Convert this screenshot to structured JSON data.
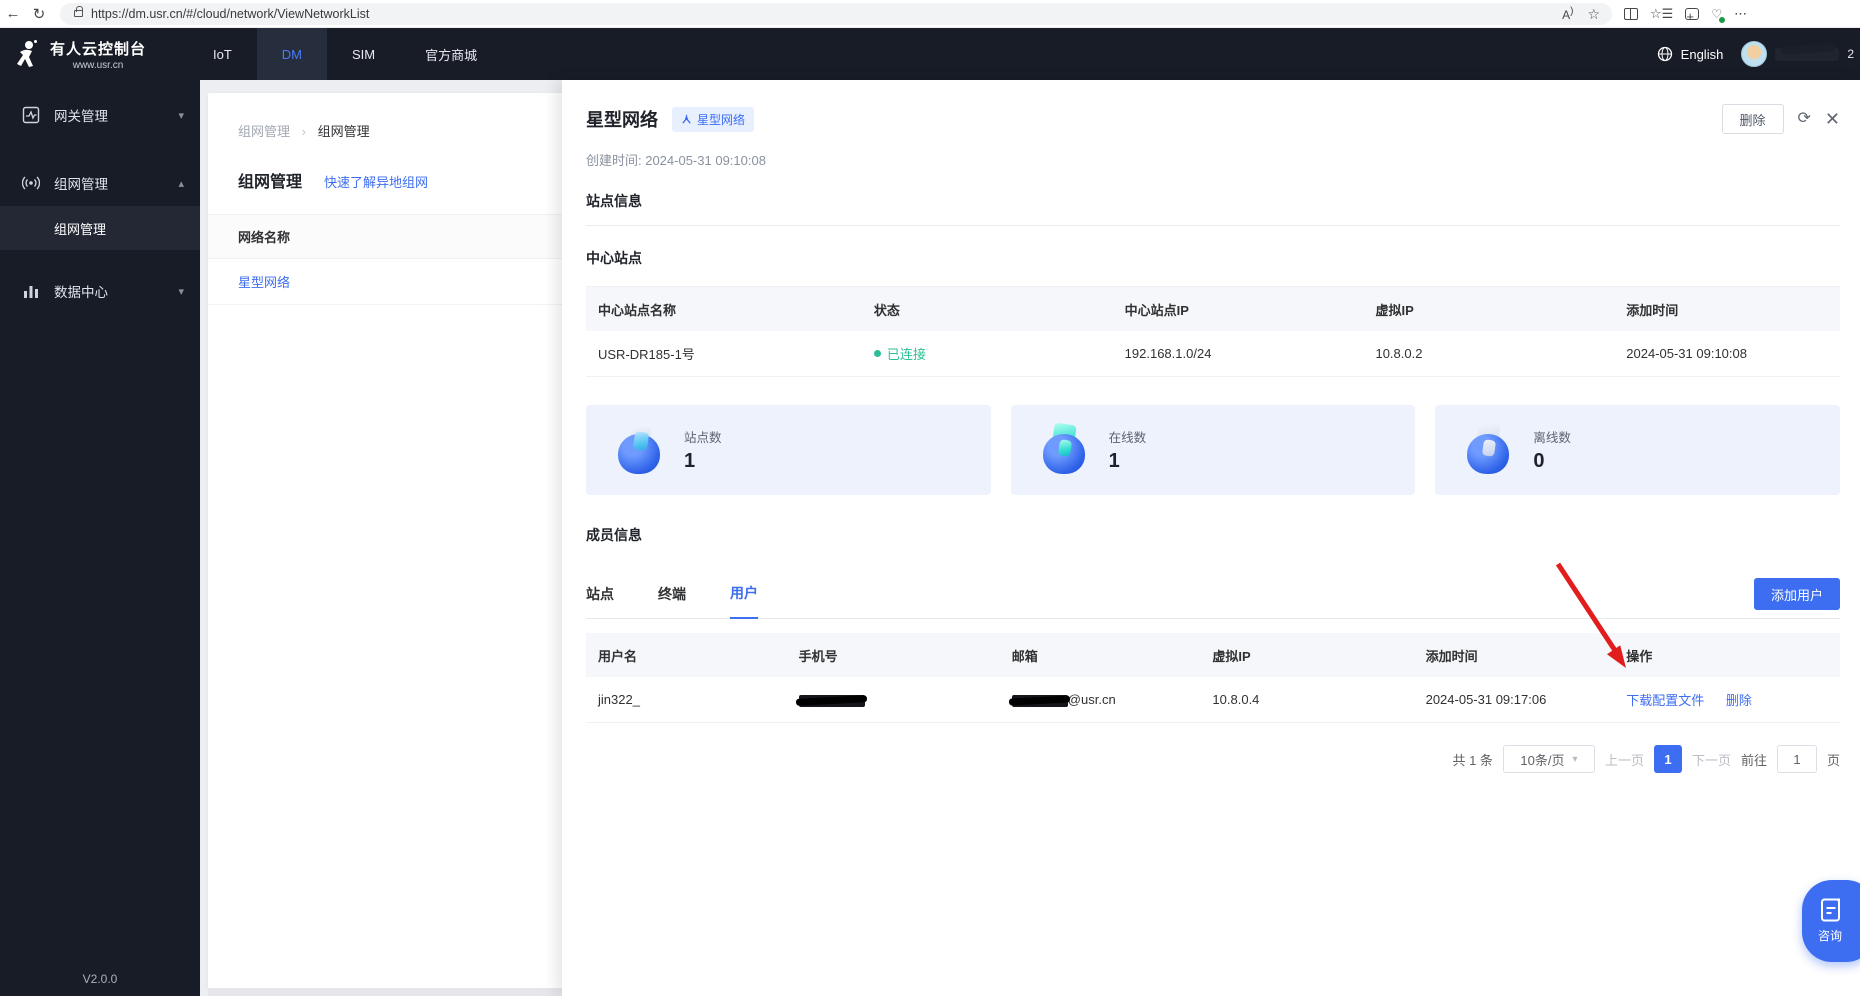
{
  "browser": {
    "url": "https://dm.usr.cn/#/cloud/network/ViewNetworkList"
  },
  "header": {
    "logo_title": "有人云控制台",
    "logo_subtitle": "www.usr.cn",
    "tabs": [
      {
        "label": "IoT"
      },
      {
        "label": "DM"
      },
      {
        "label": "SIM"
      },
      {
        "label": "官方商城"
      }
    ],
    "language": "English",
    "username_suffix": "2"
  },
  "sidebar": {
    "items": [
      {
        "label": "网关管理"
      },
      {
        "label": "组网管理"
      },
      {
        "label": "数据中心"
      }
    ],
    "sub_item": {
      "label": "组网管理"
    },
    "version": "V2.0.0"
  },
  "list_panel": {
    "breadcrumb": {
      "parent": "组网管理",
      "current": "组网管理"
    },
    "title": "组网管理",
    "help_link": "快速了解异地组网",
    "table_header": "网络名称",
    "rows": [
      {
        "name": "星型网络"
      }
    ]
  },
  "detail": {
    "title": "星型网络",
    "badge": "星型网络",
    "created": "创建时间: 2024-05-31 09:10:08",
    "delete_button": "删除",
    "section_site_info": "站点信息",
    "section_center_site": "中心站点",
    "section_member_info": "成员信息",
    "center_table": {
      "columns": [
        "中心站点名称",
        "状态",
        "中心站点IP",
        "虚拟IP",
        "添加时间"
      ],
      "rows": [
        {
          "name": "USR-DR185-1号",
          "status": "已连接",
          "ip": "192.168.1.0/24",
          "virtual_ip": "10.8.0.2",
          "added": "2024-05-31 09:10:08"
        }
      ]
    },
    "stats": [
      {
        "label": "站点数",
        "value": "1"
      },
      {
        "label": "在线数",
        "value": "1"
      },
      {
        "label": "离线数",
        "value": "0"
      }
    ],
    "member_tabs": [
      {
        "label": "站点"
      },
      {
        "label": "终端"
      },
      {
        "label": "用户"
      }
    ],
    "add_user_button": "添加用户",
    "user_table": {
      "columns": [
        "用户名",
        "手机号",
        "邮箱",
        "虚拟IP",
        "添加时间",
        "操作"
      ],
      "rows": [
        {
          "username": "jin322_",
          "email_suffix": "@usr.cn",
          "virtual_ip": "10.8.0.4",
          "added": "2024-05-31 09:17:06",
          "action_download": "下载配置文件",
          "action_delete": "删除"
        }
      ]
    },
    "pagination": {
      "total": "共 1 条",
      "page_size": "10条/页",
      "prev": "上一页",
      "page": "1",
      "next": "下一页",
      "goto_label": "前往",
      "goto_value": "1",
      "unit": "页"
    }
  },
  "float_button": {
    "label": "咨询"
  },
  "colors": {
    "accent": "#3d6ef2",
    "success": "#2cbe96",
    "dark": "#181c26",
    "arrow_red": "#e11d1d"
  }
}
